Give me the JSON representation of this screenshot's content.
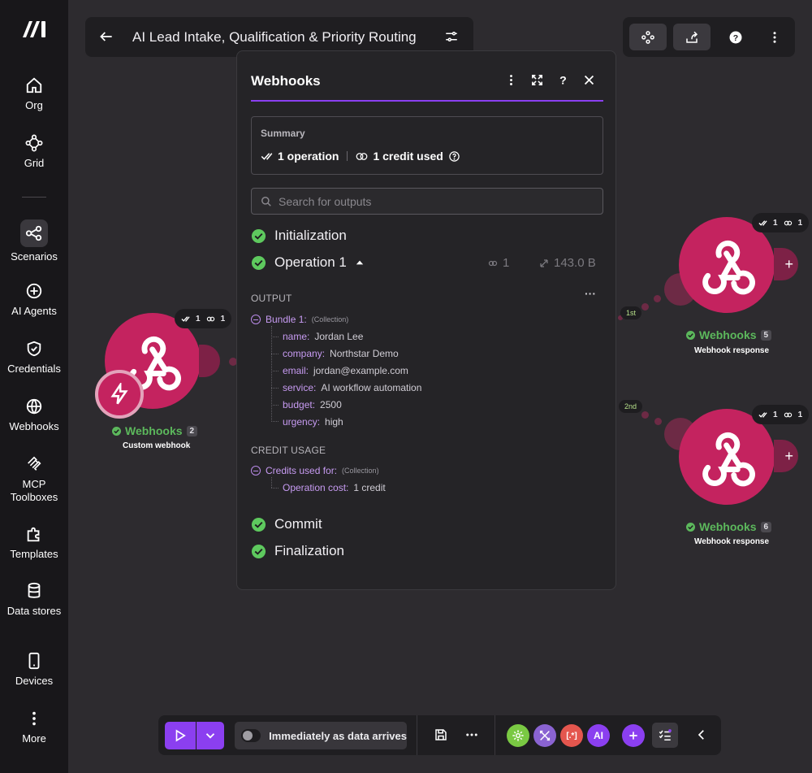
{
  "sidebar": {
    "items": [
      {
        "label": "Org",
        "icon": "home-icon"
      },
      {
        "label": "Grid",
        "icon": "grid-icon"
      },
      {
        "label": "Scenarios",
        "icon": "scenarios-icon"
      },
      {
        "label": "AI Agents",
        "icon": "ai-agents-icon"
      },
      {
        "label": "Credentials",
        "icon": "shield-icon"
      },
      {
        "label": "Webhooks",
        "icon": "globe-icon"
      },
      {
        "label": "MCP Toolboxes",
        "icon": "mcp-icon"
      },
      {
        "label": "Templates",
        "icon": "puzzle-icon"
      },
      {
        "label": "Data stores",
        "icon": "database-icon"
      },
      {
        "label": "Devices",
        "icon": "device-icon"
      },
      {
        "label": "More",
        "icon": "more-vertical-icon"
      }
    ],
    "active": "Scenarios"
  },
  "header": {
    "title": "AI Lead Intake, Qualification & Priority Routing"
  },
  "canvas": {
    "nodes": [
      {
        "name": "Webhooks",
        "number": "2",
        "subtitle": "Custom webhook",
        "ops": "1",
        "credits": "1"
      },
      {
        "name": "Webhooks",
        "number": "5",
        "subtitle": "Webhook response",
        "ops": "1",
        "credits": "1"
      },
      {
        "name": "Webhooks",
        "number": "6",
        "subtitle": "Webhook response",
        "ops": "1",
        "credits": "1"
      }
    ],
    "routes": [
      "1st",
      "2nd"
    ]
  },
  "panel": {
    "title": "Webhooks",
    "summary": {
      "label": "Summary",
      "operations": "1 operation",
      "credits": "1 credit used"
    },
    "search_placeholder": "Search for outputs",
    "steps": {
      "init": "Initialization",
      "operation": "Operation 1",
      "operation_count": "1",
      "operation_size": "143.0 B",
      "commit": "Commit",
      "finalize": "Finalization"
    },
    "output": {
      "heading": "OUTPUT",
      "bundle_label": "Bundle 1:",
      "bundle_type": "(Collection)",
      "fields": [
        {
          "key": "name:",
          "value": "Jordan Lee"
        },
        {
          "key": "company:",
          "value": "Northstar Demo"
        },
        {
          "key": "email:",
          "value": "jordan@example.com"
        },
        {
          "key": "service:",
          "value": "AI workflow automation"
        },
        {
          "key": "budget:",
          "value": "2500"
        },
        {
          "key": "urgency:",
          "value": "high"
        }
      ]
    },
    "credit_usage": {
      "heading": "CREDIT USAGE",
      "label": "Credits used for:",
      "type": "(Collection)",
      "fields": [
        {
          "key": "Operation cost:",
          "value": "1 credit"
        }
      ]
    }
  },
  "bottombar": {
    "schedule_label": "Immediately as data arrives",
    "tools": [
      {
        "icon": "gear-icon",
        "color": "#7ac943"
      },
      {
        "icon": "tools-icon",
        "color": "#8a63d2"
      },
      {
        "icon": "text-parser-icon",
        "color": "#e4564e",
        "text": "[.*]"
      },
      {
        "icon": "ai-icon",
        "color": "#8b3ff0",
        "text": "AI"
      },
      {
        "icon": "add-icon",
        "color": "#8b3ff0"
      }
    ]
  },
  "colors": {
    "accent": "#8b3ff0",
    "webhook": "#c4235f",
    "success": "#5cb85c"
  }
}
